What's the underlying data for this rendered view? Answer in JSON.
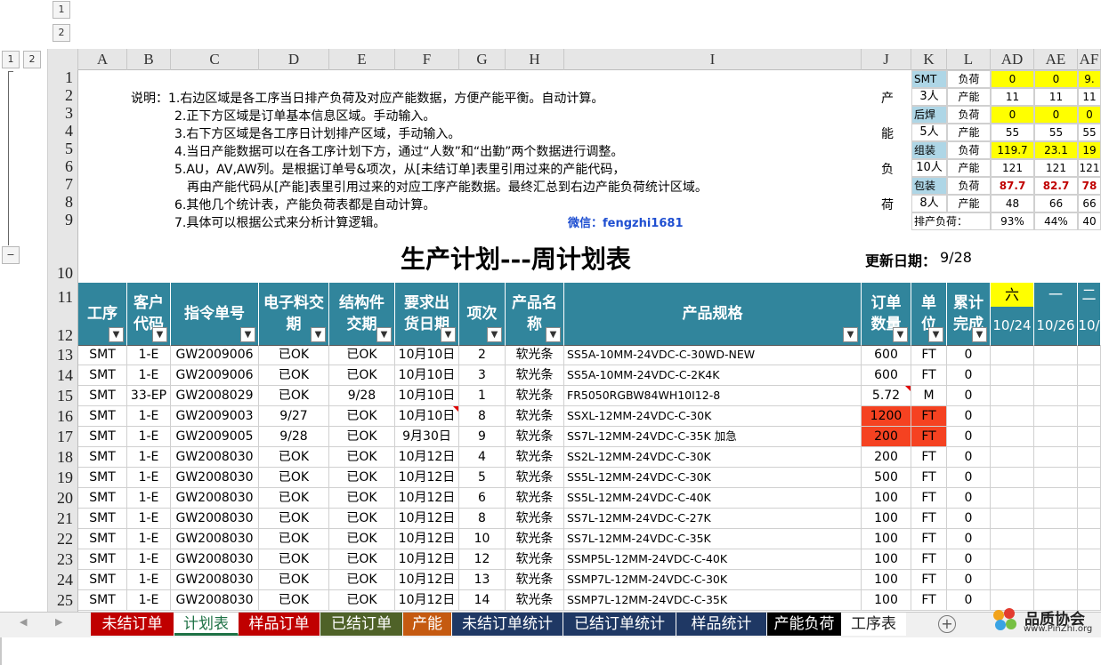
{
  "outline": {
    "top_levels": [
      "1",
      "2"
    ],
    "left_levels": [
      "1",
      "2"
    ],
    "collapse": "−"
  },
  "columns": [
    "A",
    "B",
    "C",
    "D",
    "E",
    "F",
    "G",
    "H",
    "I",
    "J",
    "K",
    "L",
    "AD",
    "AE",
    "AF"
  ],
  "notes": [
    "说明：1.右边区域是各工序当日排产负荷及对应产能数据，方便产能平衡。自动计算。",
    "2.正下方区域是订单基本信息区域。手动输入。",
    "3.右下方区域是各工序日计划排产区域，手动输入。",
    "4.当日产能数据可以在各工序计划下方，通过“人数”和“出勤”两个数据进行调整。",
    "5.AU，AV,AW列。是根据订单号&项次，从[未结订单]表里引用过来的产能代码，",
    "再由产能代码从[产能]表里引用过来的对应工序产能数据。最终汇总到右边产能负荷统计区域。",
    "6.其他几个统计表，产能负荷表都是自动计算。",
    "7.具体可以根据公式来分析计算逻辑。"
  ],
  "wechat": "微信：fengzhi1681",
  "vertical_label": [
    "产",
    "能",
    "负",
    "荷"
  ],
  "title": "生产计划---周计划表",
  "update_label": "更新日期：",
  "update_date": "9/28",
  "capacity": {
    "sections": [
      {
        "proc": "SMT",
        "people": "3人",
        "load_label": "负荷",
        "cap_label": "产能",
        "load": [
          "0",
          "0",
          "9."
        ],
        "cap": [
          "11",
          "11",
          "11"
        ],
        "hot": false
      },
      {
        "proc": "后焊",
        "people": "5人",
        "load_label": "负荷",
        "cap_label": "产能",
        "load": [
          "0",
          "0",
          "0"
        ],
        "cap": [
          "55",
          "55",
          "55"
        ],
        "hot": false
      },
      {
        "proc": "组装",
        "people": "10人",
        "load_label": "负荷",
        "cap_label": "产能",
        "load": [
          "119.7",
          "23.1",
          "19"
        ],
        "cap": [
          "121",
          "121",
          "121"
        ],
        "hot": false
      },
      {
        "proc": "包装",
        "people": "8人",
        "load_label": "负荷",
        "cap_label": "产能",
        "load": [
          "87.7",
          "82.7",
          "78"
        ],
        "cap": [
          "48",
          "66",
          "66"
        ],
        "hot": true
      }
    ],
    "total_label": "排产负荷：",
    "total": [
      "93%",
      "44%",
      "40"
    ]
  },
  "headers": [
    "工序",
    "客户代码",
    "指令单号",
    "电子料交期",
    "结构件交期",
    "要求出货日期",
    "项次",
    "产品名称",
    "产品规格",
    "订单数量",
    "单位",
    "累计完成"
  ],
  "day_headers": {
    "weekday": [
      "六",
      "一",
      "二"
    ],
    "date": [
      "10/24",
      "10/26",
      "10/"
    ]
  },
  "rows": [
    {
      "n": "13",
      "c": [
        "SMT",
        "1-E",
        "GW2009006",
        "已OK",
        "已OK",
        "10月10日",
        "2",
        "软光条",
        "SS5A-10MM-24VDC-C-30WD-NEW",
        "600",
        "FT",
        "0"
      ]
    },
    {
      "n": "14",
      "c": [
        "SMT",
        "1-E",
        "GW2009006",
        "已OK",
        "已OK",
        "10月10日",
        "3",
        "软光条",
        "SS5A-10MM-24VDC-C-2K4K",
        "600",
        "FT",
        "0"
      ]
    },
    {
      "n": "15",
      "c": [
        "SMT",
        "33-EP",
        "GW2008029",
        "已OK",
        "9/28",
        "10月10日",
        "1",
        "软光条",
        "FR5050RGBW84WH10I12-8",
        "5.72",
        "M",
        "0"
      ]
    },
    {
      "n": "16",
      "c": [
        "SMT",
        "1-E",
        "GW2009003",
        "9/27",
        "已OK",
        "10月10日",
        "8",
        "软光条",
        "SSXL-12MM-24VDC-C-30K",
        "1200",
        "FT",
        "0"
      ],
      "red": true
    },
    {
      "n": "17",
      "c": [
        "SMT",
        "1-E",
        "GW2009005",
        "9/28",
        "已OK",
        "9月30日",
        "9",
        "软光条",
        "SS7L-12MM-24VDC-C-35K  加急",
        "200",
        "FT",
        "0"
      ],
      "red": true
    },
    {
      "n": "18",
      "c": [
        "SMT",
        "1-E",
        "GW2008030",
        "已OK",
        "已OK",
        "10月12日",
        "4",
        "软光条",
        "SS2L-12MM-24VDC-C-30K",
        "200",
        "FT",
        "0"
      ]
    },
    {
      "n": "19",
      "c": [
        "SMT",
        "1-E",
        "GW2008030",
        "已OK",
        "已OK",
        "10月12日",
        "5",
        "软光条",
        "SS5L-12MM-24VDC-C-30K",
        "500",
        "FT",
        "0"
      ]
    },
    {
      "n": "20",
      "c": [
        "SMT",
        "1-E",
        "GW2008030",
        "已OK",
        "已OK",
        "10月12日",
        "6",
        "软光条",
        "SS5L-12MM-24VDC-C-40K",
        "100",
        "FT",
        "0"
      ]
    },
    {
      "n": "21",
      "c": [
        "SMT",
        "1-E",
        "GW2008030",
        "已OK",
        "已OK",
        "10月12日",
        "8",
        "软光条",
        "SS7L-12MM-24VDC-C-27K",
        "100",
        "FT",
        "0"
      ]
    },
    {
      "n": "22",
      "c": [
        "SMT",
        "1-E",
        "GW2008030",
        "已OK",
        "已OK",
        "10月12日",
        "10",
        "软光条",
        "SS7L-12MM-24VDC-C-35K",
        "100",
        "FT",
        "0"
      ]
    },
    {
      "n": "23",
      "c": [
        "SMT",
        "1-E",
        "GW2008030",
        "已OK",
        "已OK",
        "10月12日",
        "12",
        "软光条",
        "SSMP5L-12MM-24VDC-C-40K",
        "100",
        "FT",
        "0"
      ]
    },
    {
      "n": "24",
      "c": [
        "SMT",
        "1-E",
        "GW2008030",
        "已OK",
        "已OK",
        "10月12日",
        "13",
        "软光条",
        "SSMP7L-12MM-24VDC-C-30K",
        "100",
        "FT",
        "0"
      ]
    },
    {
      "n": "25",
      "c": [
        "SMT",
        "1-E",
        "GW2008030",
        "已OK",
        "已OK",
        "10月12日",
        "14",
        "软光条",
        "SSMP7L-12MM-24VDC-C-35K",
        "100",
        "FT",
        "0"
      ]
    }
  ],
  "tabs": [
    {
      "label": "未结订单",
      "color": "#c00000"
    },
    {
      "label": "计划表",
      "color": "#ffffff",
      "active": true
    },
    {
      "label": "样品订单",
      "color": "#c00000"
    },
    {
      "label": "已结订单",
      "color": "#4f6228"
    },
    {
      "label": "产能",
      "color": "#c55a11"
    },
    {
      "label": "未结订单统计",
      "color": "#1f3864"
    },
    {
      "label": "已结订单统计",
      "color": "#1f3864"
    },
    {
      "label": "样品统计",
      "color": "#1f3864"
    },
    {
      "label": "产能负荷",
      "color": "#000000"
    },
    {
      "label": "工序表",
      "color": "#ffffff"
    }
  ],
  "nav": {
    "prev": "◀",
    "next": "▶",
    "add": "+"
  },
  "watermark": {
    "name": "品质协会",
    "url": "www.PinZhi.org"
  }
}
